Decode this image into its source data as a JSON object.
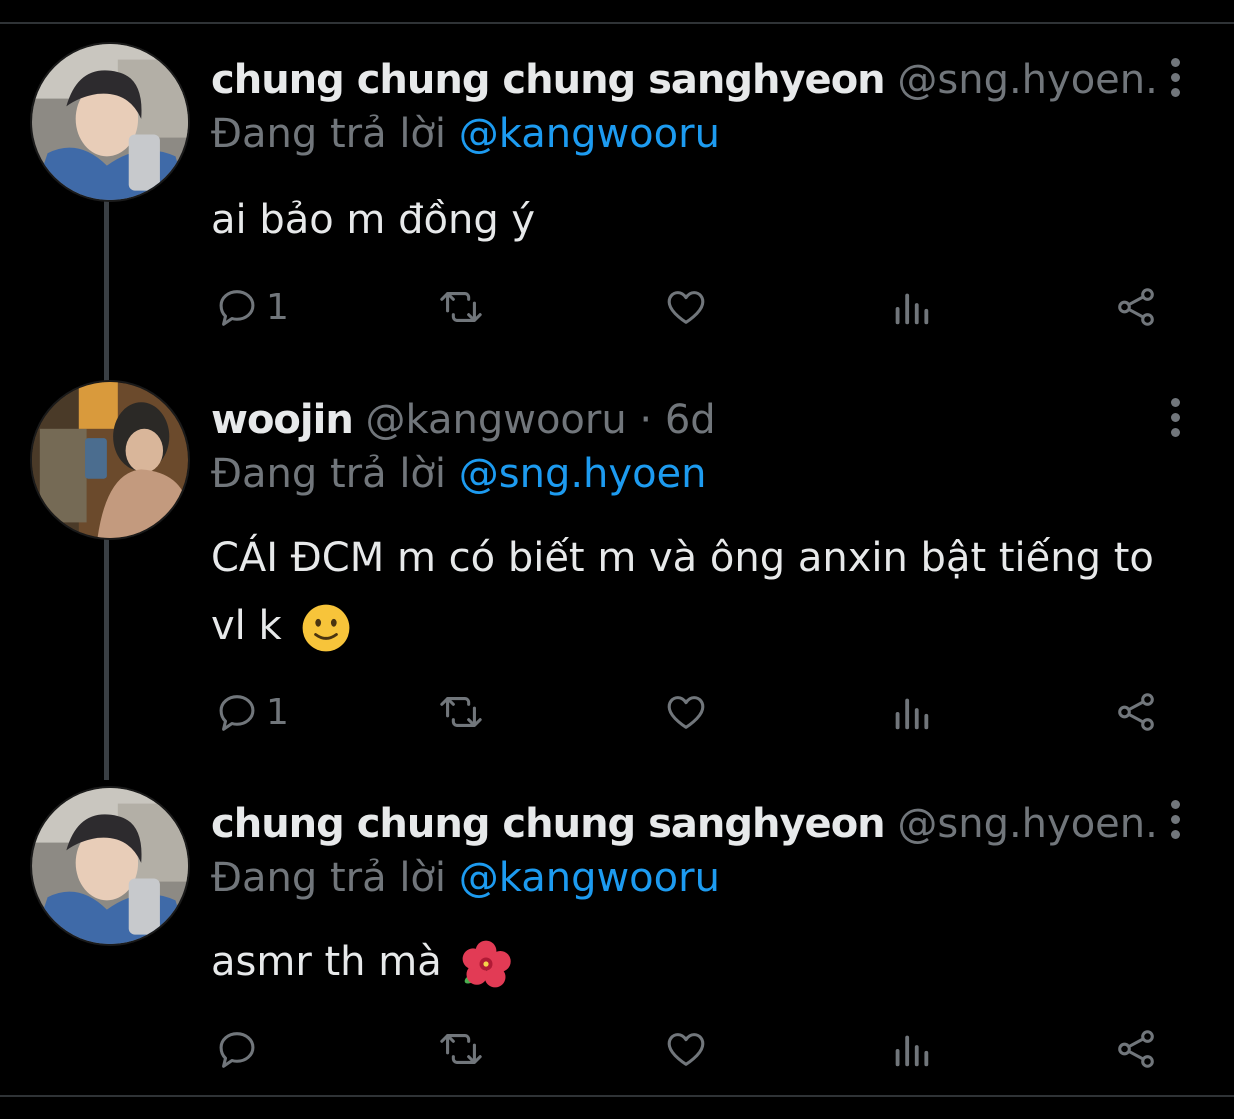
{
  "tweets": [
    {
      "name": "chung chung chung sanghyeon",
      "handle": "@sng.hyoen...",
      "time": "",
      "reply_prefix": "Đang trả lời",
      "reply_to": "@kangwooru",
      "text": "ai bảo m đồng ý",
      "emoji": "",
      "reply_count": "1"
    },
    {
      "name": "woojin",
      "handle": "@kangwooru · 6d",
      "time": "",
      "reply_prefix": "Đang trả lời",
      "reply_to": "@sng.hyoen",
      "text": "CÁI ĐCM m có biết m và ông anxin bật tiếng to vl k",
      "emoji": "slightly-smiling-face",
      "reply_count": "1"
    },
    {
      "name": "chung chung chung sanghyeon",
      "handle": "@sng.hyoen...",
      "time": "",
      "reply_prefix": "Đang trả lời",
      "reply_to": "@kangwooru",
      "text": "asmr th mà",
      "emoji": "hibiscus",
      "reply_count": ""
    }
  ],
  "colors": {
    "background": "#000000",
    "text": "#e7e9ea",
    "muted": "#71767b",
    "mention": "#1d9bf0",
    "thread_line": "#3a3f44"
  },
  "icons": [
    "reply-icon",
    "retweet-icon",
    "like-icon",
    "views-icon",
    "share-icon",
    "more-icon"
  ]
}
